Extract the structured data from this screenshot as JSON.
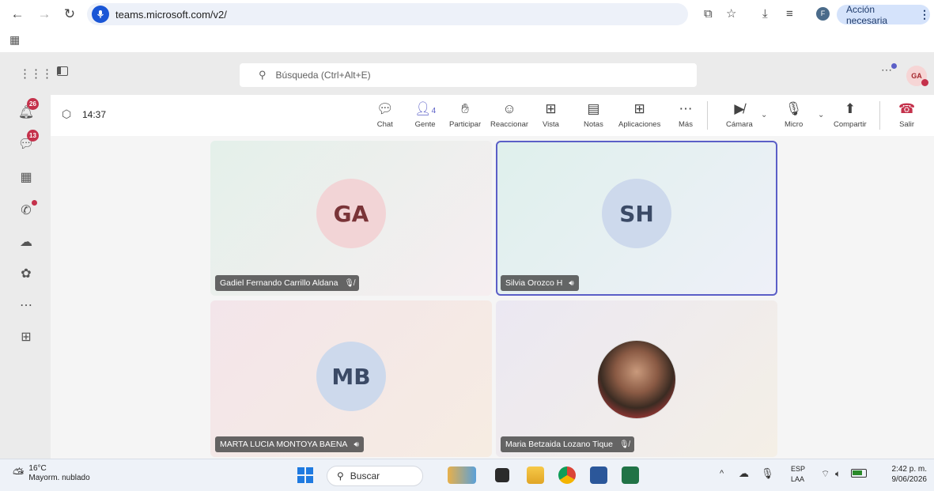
{
  "browser": {
    "url": "teams.microsoft.com/v2/",
    "action_label": "Acción necesaria",
    "profile_initial": "F"
  },
  "teams": {
    "search_placeholder": "Búsqueda (Ctrl+Alt+E)",
    "user_initials": "GA",
    "rail_badges": {
      "activity": "26",
      "chat": "13"
    },
    "meeting_time": "14:37",
    "people_count": "4",
    "toolbar": {
      "chat": "Chat",
      "people": "Gente",
      "raise": "Participar",
      "react": "Reaccionar",
      "view": "Vista",
      "notes": "Notas",
      "apps": "Aplicaciones",
      "more": "Más",
      "camera": "Cámara",
      "mic": "Micro",
      "share": "Compartir",
      "leave": "Salir"
    },
    "participants": [
      {
        "initials": "GA",
        "name": "Gadiel Fernando Carrillo Aldana",
        "status": "muted"
      },
      {
        "initials": "SH",
        "name": "Silvia Orozco H",
        "status": "speaking"
      },
      {
        "initials": "MB",
        "name": "MARTA LUCIA MONTOYA BAENA",
        "status": "speaking"
      },
      {
        "initials": "",
        "name": "Maria Betzaida Lozano Tique",
        "status": "muted"
      }
    ]
  },
  "taskbar": {
    "temperature": "16°C",
    "weather": "Mayorm. nublado",
    "search_label": "Buscar",
    "lang1": "ESP",
    "lang2": "LAA",
    "time": "2:42 p. m.",
    "date": "9/06/2026"
  },
  "colors": {
    "accent": "#5b5fc7",
    "leave": "#c4314b",
    "badge": "#c4314b"
  }
}
